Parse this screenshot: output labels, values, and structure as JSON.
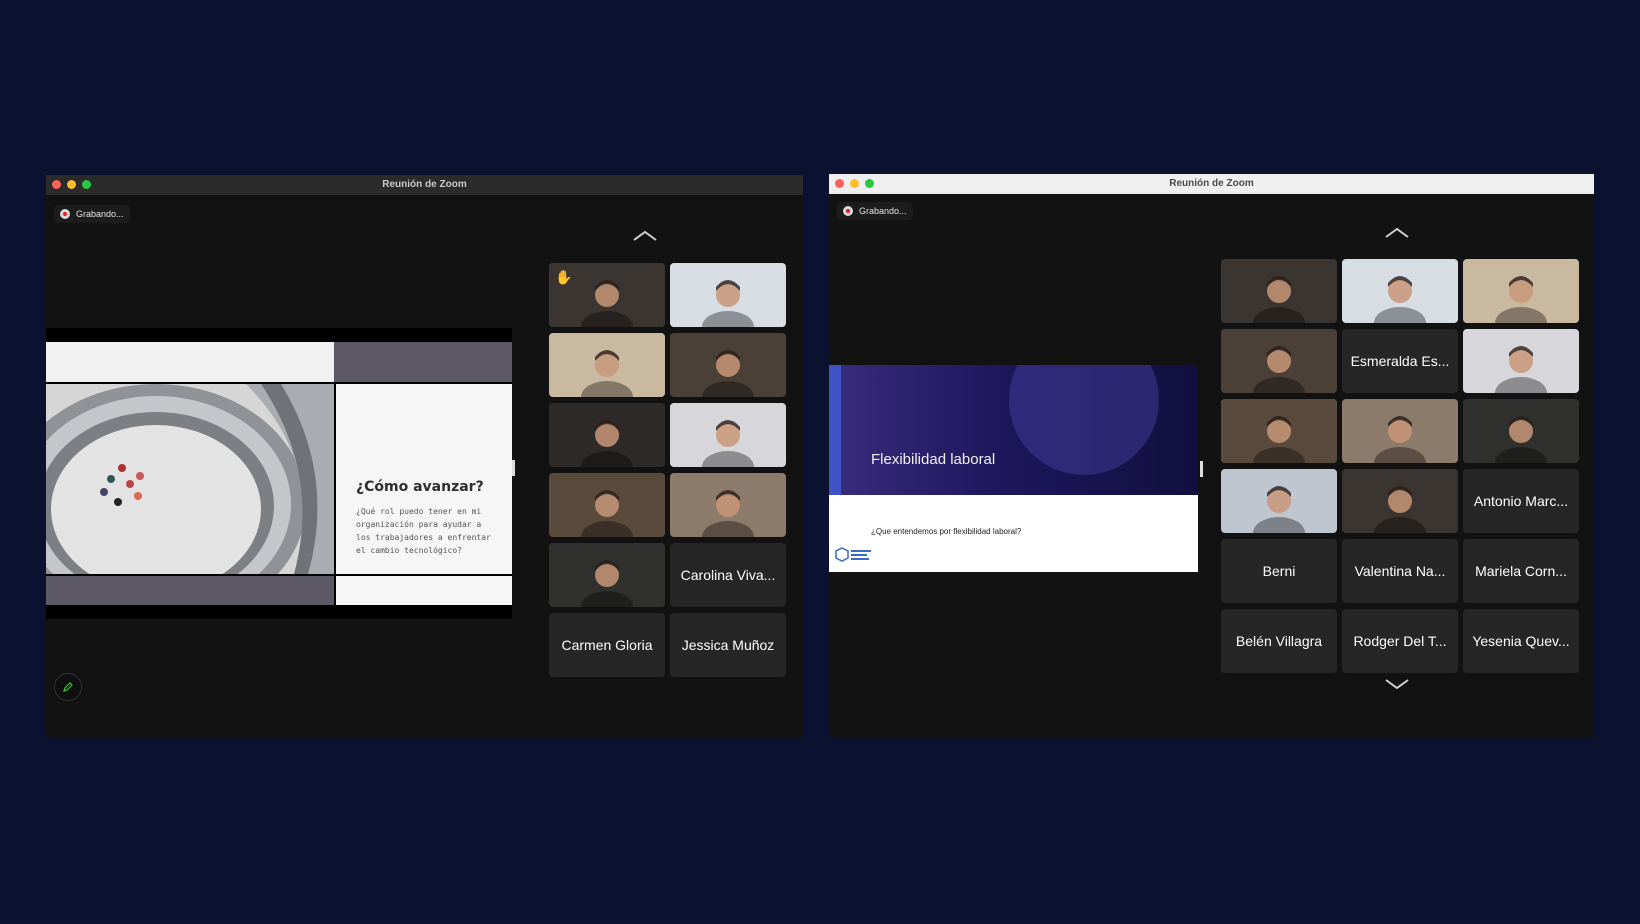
{
  "left_window": {
    "title": "Reunión de Zoom",
    "recording_label": "Grabando...",
    "slide": {
      "title": "¿Cómo avanzar?",
      "body": "¿Qué rol puedo tener en mi organización para ayudar a los trabajadores a enfrentar el cambio tecnológico?"
    },
    "participants": [
      {
        "name": "",
        "video": true,
        "hand_raised": true,
        "active": true
      },
      {
        "name": "",
        "video": true
      },
      {
        "name": "",
        "video": true
      },
      {
        "name": "",
        "video": true
      },
      {
        "name": "",
        "video": true
      },
      {
        "name": "",
        "video": true
      },
      {
        "name": "",
        "video": true
      },
      {
        "name": "",
        "video": true
      },
      {
        "name": "",
        "video": true
      },
      {
        "name": "Carolina Viva...",
        "video": false
      },
      {
        "name": "Carmen Gloria",
        "video": false
      },
      {
        "name": "Jessica Muñoz",
        "video": false
      }
    ]
  },
  "right_window": {
    "title": "Reunión de Zoom",
    "recording_label": "Grabando...",
    "slide": {
      "title": "Flexibilidad laboral",
      "question": "¿Que entendemos por flexibilidad laboral?"
    },
    "participants": [
      {
        "name": "",
        "video": true
      },
      {
        "name": "",
        "video": true
      },
      {
        "name": "",
        "video": true
      },
      {
        "name": "",
        "video": true
      },
      {
        "name": "Esmeralda Es...",
        "video": false
      },
      {
        "name": "",
        "video": true
      },
      {
        "name": "",
        "video": true,
        "active": true
      },
      {
        "name": "",
        "video": true
      },
      {
        "name": "",
        "video": true
      },
      {
        "name": "",
        "video": true
      },
      {
        "name": "",
        "video": true
      },
      {
        "name": "Antonio Marc...",
        "video": false
      },
      {
        "name": "Berni",
        "video": false
      },
      {
        "name": "Valentina Na...",
        "video": false
      },
      {
        "name": "Mariela Corn...",
        "video": false
      },
      {
        "name": "Belén Villagra",
        "video": false
      },
      {
        "name": "Rodger Del T...",
        "video": false
      },
      {
        "name": "Yesenia Quev...",
        "video": false
      }
    ]
  },
  "colors": {
    "desktop": "#0b1230",
    "active_speaker": "#3ac43a",
    "tile_bg": "#262626"
  },
  "icons": [
    "record-icon",
    "chevron-up-icon",
    "chevron-down-icon",
    "pencil-icon",
    "raised-hand-icon"
  ]
}
